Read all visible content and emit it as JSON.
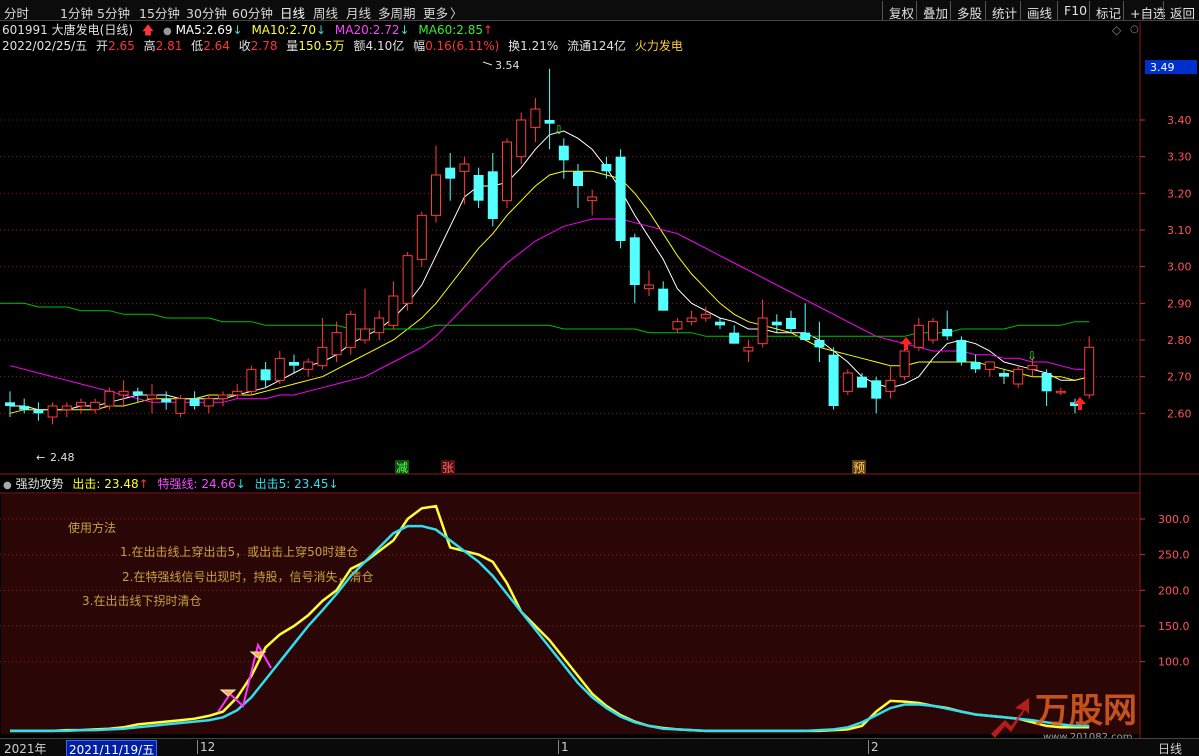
{
  "toolbar": {
    "periods": [
      "分时",
      "1分钟",
      "5分钟",
      "15分钟",
      "30分钟",
      "60分钟",
      "日线",
      "周线",
      "月线",
      "多周期",
      "更多"
    ],
    "active_period": "日线",
    "more_arrow": "〉",
    "tools": [
      "复权",
      "叠加",
      "多股",
      "统计",
      "画线",
      "F10",
      "标记",
      "+自选",
      "返回"
    ]
  },
  "stock": {
    "code": "601991",
    "name": "大唐发电(日线)",
    "ma5_label": "MA5:",
    "ma5": "2.69",
    "ma10_label": "MA10:",
    "ma10": "2.70",
    "ma20_label": "MA20:",
    "ma20": "2.72",
    "ma60_label": "MA60:",
    "ma60": "2.85",
    "date": "2022/02/25/五",
    "open_label": "开",
    "open": "2.65",
    "high_label": "高",
    "high": "2.81",
    "low_label": "低",
    "low": "2.64",
    "close_label": "收",
    "close": "2.78",
    "volume_label": "量",
    "volume": "150.5万",
    "amount_label": "额",
    "amount": "4.10亿",
    "change_label": "幅",
    "change": "0.16(6.11%)",
    "turnover_label": "换",
    "turnover": "1.21%",
    "float_label": "流通",
    "float_cap": "124亿",
    "concept": "火力发电"
  },
  "indicator": {
    "name": "强劲攻势",
    "chuji_label": "出击:",
    "chuji": "23.48",
    "teqiang_label": "特强线:",
    "teqiang": "24.66",
    "chuji5_label": "出击5:",
    "chuji5": "23.45",
    "notes": [
      "使用方法",
      "1.在出击线上穿出击5，或出击上穿50时建仓",
      "2.在特强线信号出现时，持股，信号消失，清仓",
      "3.在出击线下拐时清仓"
    ]
  },
  "markers": {
    "jian": "减",
    "zhang": "张",
    "yu": "预",
    "high_price": "3.54",
    "low_price": "2.48",
    "current_price": "3.49"
  },
  "bottom": {
    "year": "2021年",
    "cursor_date": "2021/11/19/五",
    "month12": "12",
    "month1": "1",
    "month2": "2",
    "view_mode": "日线"
  },
  "watermark": {
    "brand": "万股网",
    "site": "www.201082.com"
  },
  "colors": {
    "up": "#ff3c3c",
    "down": "#54ffff",
    "ma5": "#ffffff",
    "ma10": "#ffff00",
    "ma20": "#ff00ff",
    "ma60": "#00c000",
    "chuji": "#ffff33",
    "chuji5": "#33ddee",
    "teqiang": "#ff33ff",
    "note": "#c8a040",
    "grid": "#8a1a1a"
  },
  "chart_data": [
    {
      "type": "candlestick",
      "title": "601991 大唐发电(日线)",
      "y_ticks": [
        2.6,
        2.7,
        2.8,
        2.9,
        3.0,
        3.1,
        3.2,
        3.3,
        3.4
      ],
      "ylim": [
        2.44,
        3.58
      ],
      "candles": [
        {
          "o": 2.63,
          "h": 2.66,
          "l": 2.59,
          "c": 2.62
        },
        {
          "o": 2.62,
          "h": 2.64,
          "l": 2.6,
          "c": 2.61
        },
        {
          "o": 2.61,
          "h": 2.63,
          "l": 2.58,
          "c": 2.6
        },
        {
          "o": 2.59,
          "h": 2.63,
          "l": 2.57,
          "c": 2.62
        },
        {
          "o": 2.61,
          "h": 2.63,
          "l": 2.59,
          "c": 2.62
        },
        {
          "o": 2.62,
          "h": 2.64,
          "l": 2.6,
          "c": 2.63
        },
        {
          "o": 2.61,
          "h": 2.64,
          "l": 2.6,
          "c": 2.63
        },
        {
          "o": 2.62,
          "h": 2.67,
          "l": 2.61,
          "c": 2.66
        },
        {
          "o": 2.65,
          "h": 2.69,
          "l": 2.62,
          "c": 2.66
        },
        {
          "o": 2.66,
          "h": 2.67,
          "l": 2.63,
          "c": 2.65
        },
        {
          "o": 2.64,
          "h": 2.68,
          "l": 2.6,
          "c": 2.65
        },
        {
          "o": 2.64,
          "h": 2.66,
          "l": 2.61,
          "c": 2.63
        },
        {
          "o": 2.6,
          "h": 2.65,
          "l": 2.59,
          "c": 2.64
        },
        {
          "o": 2.64,
          "h": 2.66,
          "l": 2.61,
          "c": 2.62
        },
        {
          "o": 2.62,
          "h": 2.65,
          "l": 2.6,
          "c": 2.64
        },
        {
          "o": 2.64,
          "h": 2.66,
          "l": 2.62,
          "c": 2.65
        },
        {
          "o": 2.65,
          "h": 2.68,
          "l": 2.64,
          "c": 2.66
        },
        {
          "o": 2.66,
          "h": 2.73,
          "l": 2.65,
          "c": 2.72
        },
        {
          "o": 2.72,
          "h": 2.74,
          "l": 2.67,
          "c": 2.69
        },
        {
          "o": 2.69,
          "h": 2.77,
          "l": 2.68,
          "c": 2.75
        },
        {
          "o": 2.74,
          "h": 2.76,
          "l": 2.71,
          "c": 2.73
        },
        {
          "o": 2.72,
          "h": 2.75,
          "l": 2.7,
          "c": 2.74
        },
        {
          "o": 2.73,
          "h": 2.86,
          "l": 2.72,
          "c": 2.78
        },
        {
          "o": 2.76,
          "h": 2.85,
          "l": 2.74,
          "c": 2.82
        },
        {
          "o": 2.78,
          "h": 2.88,
          "l": 2.76,
          "c": 2.87
        },
        {
          "o": 2.8,
          "h": 2.94,
          "l": 2.79,
          "c": 2.83
        },
        {
          "o": 2.82,
          "h": 2.88,
          "l": 2.8,
          "c": 2.86
        },
        {
          "o": 2.84,
          "h": 2.96,
          "l": 2.83,
          "c": 2.92
        },
        {
          "o": 2.9,
          "h": 3.04,
          "l": 2.88,
          "c": 3.03
        },
        {
          "o": 3.02,
          "h": 3.15,
          "l": 3.0,
          "c": 3.14
        },
        {
          "o": 3.14,
          "h": 3.33,
          "l": 3.12,
          "c": 3.25
        },
        {
          "o": 3.27,
          "h": 3.31,
          "l": 3.18,
          "c": 3.24
        },
        {
          "o": 3.26,
          "h": 3.3,
          "l": 3.17,
          "c": 3.28
        },
        {
          "o": 3.25,
          "h": 3.27,
          "l": 3.16,
          "c": 3.18
        },
        {
          "o": 3.26,
          "h": 3.31,
          "l": 3.11,
          "c": 3.13
        },
        {
          "o": 3.18,
          "h": 3.35,
          "l": 3.16,
          "c": 3.34
        },
        {
          "o": 3.3,
          "h": 3.42,
          "l": 3.28,
          "c": 3.4
        },
        {
          "o": 3.38,
          "h": 3.46,
          "l": 3.34,
          "c": 3.43
        },
        {
          "o": 3.4,
          "h": 3.54,
          "l": 3.32,
          "c": 3.39
        },
        {
          "o": 3.33,
          "h": 3.35,
          "l": 3.24,
          "c": 3.29
        },
        {
          "o": 3.26,
          "h": 3.28,
          "l": 3.16,
          "c": 3.22
        },
        {
          "o": 3.18,
          "h": 3.21,
          "l": 3.14,
          "c": 3.19
        },
        {
          "o": 3.28,
          "h": 3.3,
          "l": 3.24,
          "c": 3.26
        },
        {
          "o": 3.3,
          "h": 3.32,
          "l": 3.05,
          "c": 3.07
        },
        {
          "o": 3.08,
          "h": 3.09,
          "l": 2.9,
          "c": 2.95
        },
        {
          "o": 2.94,
          "h": 2.99,
          "l": 2.92,
          "c": 2.95
        },
        {
          "o": 2.94,
          "h": 2.96,
          "l": 2.88,
          "c": 2.88
        },
        {
          "o": 2.83,
          "h": 2.86,
          "l": 2.82,
          "c": 2.85
        },
        {
          "o": 2.85,
          "h": 2.88,
          "l": 2.84,
          "c": 2.86
        },
        {
          "o": 2.86,
          "h": 2.89,
          "l": 2.85,
          "c": 2.87
        },
        {
          "o": 2.85,
          "h": 2.86,
          "l": 2.83,
          "c": 2.84
        },
        {
          "o": 2.82,
          "h": 2.84,
          "l": 2.79,
          "c": 2.79
        },
        {
          "o": 2.77,
          "h": 2.8,
          "l": 2.74,
          "c": 2.78
        },
        {
          "o": 2.79,
          "h": 2.91,
          "l": 2.78,
          "c": 2.86
        },
        {
          "o": 2.85,
          "h": 2.87,
          "l": 2.82,
          "c": 2.84
        },
        {
          "o": 2.86,
          "h": 2.88,
          "l": 2.82,
          "c": 2.83
        },
        {
          "o": 2.82,
          "h": 2.9,
          "l": 2.8,
          "c": 2.8
        },
        {
          "o": 2.8,
          "h": 2.85,
          "l": 2.74,
          "c": 2.78
        },
        {
          "o": 2.76,
          "h": 2.78,
          "l": 2.61,
          "c": 2.62
        },
        {
          "o": 2.66,
          "h": 2.72,
          "l": 2.65,
          "c": 2.71
        },
        {
          "o": 2.7,
          "h": 2.71,
          "l": 2.67,
          "c": 2.67
        },
        {
          "o": 2.69,
          "h": 2.7,
          "l": 2.6,
          "c": 2.64
        },
        {
          "o": 2.66,
          "h": 2.73,
          "l": 2.64,
          "c": 2.69
        },
        {
          "o": 2.7,
          "h": 2.78,
          "l": 2.69,
          "c": 2.77
        },
        {
          "o": 2.78,
          "h": 2.86,
          "l": 2.77,
          "c": 2.84
        },
        {
          "o": 2.8,
          "h": 2.86,
          "l": 2.79,
          "c": 2.85
        },
        {
          "o": 2.83,
          "h": 2.88,
          "l": 2.8,
          "c": 2.81
        },
        {
          "o": 2.8,
          "h": 2.81,
          "l": 2.73,
          "c": 2.74
        },
        {
          "o": 2.74,
          "h": 2.76,
          "l": 2.71,
          "c": 2.72
        },
        {
          "o": 2.72,
          "h": 2.74,
          "l": 2.7,
          "c": 2.74
        },
        {
          "o": 2.71,
          "h": 2.72,
          "l": 2.68,
          "c": 2.7
        },
        {
          "o": 2.68,
          "h": 2.73,
          "l": 2.67,
          "c": 2.72
        },
        {
          "o": 2.72,
          "h": 2.75,
          "l": 2.7,
          "c": 2.73
        },
        {
          "o": 2.71,
          "h": 2.72,
          "l": 2.62,
          "c": 2.66
        },
        {
          "o": 2.66,
          "h": 2.67,
          "l": 2.65,
          "c": 2.66
        },
        {
          "o": 2.63,
          "h": 2.64,
          "l": 2.6,
          "c": 2.62
        },
        {
          "o": 2.65,
          "h": 2.81,
          "l": 2.64,
          "c": 2.78
        }
      ],
      "series": [
        {
          "name": "MA5",
          "values": [
            2.62,
            2.62,
            2.61,
            2.61,
            2.61,
            2.62,
            2.62,
            2.63,
            2.64,
            2.65,
            2.65,
            2.65,
            2.64,
            2.64,
            2.64,
            2.64,
            2.65,
            2.66,
            2.67,
            2.69,
            2.71,
            2.73,
            2.74,
            2.76,
            2.79,
            2.81,
            2.83,
            2.86,
            2.9,
            2.95,
            3.03,
            3.11,
            3.19,
            3.22,
            3.22,
            3.23,
            3.27,
            3.32,
            3.36,
            3.37,
            3.35,
            3.32,
            3.27,
            3.21,
            3.14,
            3.08,
            3.02,
            2.94,
            2.9,
            2.88,
            2.86,
            2.85,
            2.83,
            2.83,
            2.82,
            2.82,
            2.82,
            2.8,
            2.77,
            2.74,
            2.7,
            2.68,
            2.67,
            2.68,
            2.7,
            2.75,
            2.79,
            2.8,
            2.79,
            2.77,
            2.74,
            2.73,
            2.72,
            2.71,
            2.69,
            2.69,
            2.7
          ]
        },
        {
          "name": "MA10",
          "values": [
            2.6,
            2.61,
            2.61,
            2.61,
            2.61,
            2.61,
            2.61,
            2.62,
            2.62,
            2.63,
            2.64,
            2.64,
            2.64,
            2.64,
            2.65,
            2.65,
            2.65,
            2.65,
            2.66,
            2.67,
            2.68,
            2.69,
            2.7,
            2.72,
            2.74,
            2.76,
            2.78,
            2.8,
            2.83,
            2.86,
            2.9,
            2.95,
            3.0,
            3.05,
            3.09,
            3.14,
            3.18,
            3.22,
            3.25,
            3.26,
            3.26,
            3.26,
            3.25,
            3.24,
            3.2,
            3.15,
            3.09,
            3.03,
            2.98,
            2.94,
            2.9,
            2.87,
            2.85,
            2.84,
            2.83,
            2.82,
            2.8,
            2.78,
            2.77,
            2.76,
            2.75,
            2.74,
            2.73,
            2.73,
            2.74,
            2.74,
            2.74,
            2.74,
            2.74,
            2.73,
            2.72,
            2.71,
            2.7,
            2.7,
            2.7,
            2.69,
            2.7
          ]
        },
        {
          "name": "MA20",
          "values": [
            2.73,
            2.72,
            2.71,
            2.7,
            2.69,
            2.68,
            2.67,
            2.66,
            2.65,
            2.64,
            2.63,
            2.63,
            2.63,
            2.63,
            2.63,
            2.63,
            2.64,
            2.64,
            2.64,
            2.65,
            2.65,
            2.66,
            2.67,
            2.68,
            2.69,
            2.7,
            2.72,
            2.74,
            2.76,
            2.78,
            2.81,
            2.85,
            2.89,
            2.93,
            2.97,
            3.01,
            3.04,
            3.07,
            3.09,
            3.11,
            3.12,
            3.13,
            3.13,
            3.13,
            3.12,
            3.11,
            3.1,
            3.09,
            3.07,
            3.05,
            3.03,
            3.01,
            2.99,
            2.97,
            2.95,
            2.93,
            2.91,
            2.89,
            2.87,
            2.85,
            2.83,
            2.81,
            2.8,
            2.79,
            2.78,
            2.77,
            2.77,
            2.77,
            2.76,
            2.76,
            2.75,
            2.75,
            2.74,
            2.74,
            2.73,
            2.72,
            2.72
          ]
        },
        {
          "name": "MA60",
          "values": [
            2.9,
            2.9,
            2.89,
            2.89,
            2.89,
            2.88,
            2.88,
            2.88,
            2.87,
            2.87,
            2.87,
            2.86,
            2.86,
            2.86,
            2.86,
            2.85,
            2.85,
            2.85,
            2.84,
            2.84,
            2.84,
            2.84,
            2.84,
            2.84,
            2.83,
            2.83,
            2.83,
            2.83,
            2.83,
            2.83,
            2.84,
            2.84,
            2.84,
            2.84,
            2.84,
            2.84,
            2.84,
            2.84,
            2.84,
            2.83,
            2.83,
            2.83,
            2.83,
            2.83,
            2.83,
            2.82,
            2.82,
            2.82,
            2.82,
            2.81,
            2.81,
            2.81,
            2.81,
            2.81,
            2.81,
            2.81,
            2.81,
            2.81,
            2.81,
            2.81,
            2.81,
            2.81,
            2.81,
            2.81,
            2.82,
            2.82,
            2.82,
            2.83,
            2.83,
            2.83,
            2.83,
            2.84,
            2.84,
            2.84,
            2.84,
            2.85,
            2.85
          ]
        }
      ]
    },
    {
      "type": "line",
      "title": "强劲攻势",
      "y_ticks": [
        100,
        150,
        200,
        250,
        300
      ],
      "ylim": [
        0,
        335
      ],
      "series": [
        {
          "name": "出击",
          "values": [
            3,
            3,
            3,
            3,
            4,
            4,
            5,
            6,
            8,
            12,
            14,
            16,
            18,
            20,
            24,
            30,
            50,
            80,
            120,
            138,
            150,
            165,
            185,
            200,
            230,
            240,
            255,
            270,
            300,
            315,
            318,
            260,
            255,
            250,
            240,
            210,
            170,
            150,
            130,
            105,
            80,
            55,
            38,
            25,
            16,
            10,
            7,
            5,
            4,
            3,
            3,
            3,
            3,
            3,
            3,
            3,
            3,
            3,
            4,
            5,
            10,
            30,
            45,
            44,
            42,
            38,
            35,
            30,
            26,
            24,
            22,
            20,
            15,
            10,
            8,
            8,
            8
          ]
        },
        {
          "name": "出击5",
          "values": [
            3,
            3,
            3,
            3,
            3,
            4,
            4,
            5,
            6,
            8,
            10,
            12,
            14,
            16,
            18,
            22,
            32,
            50,
            75,
            100,
            125,
            150,
            172,
            195,
            220,
            240,
            260,
            280,
            290,
            290,
            285,
            270,
            255,
            240,
            220,
            195,
            170,
            145,
            120,
            95,
            70,
            50,
            35,
            23,
            15,
            10,
            6,
            5,
            4,
            3,
            3,
            3,
            3,
            3,
            3,
            3,
            3,
            4,
            5,
            8,
            15,
            25,
            35,
            40,
            40,
            38,
            34,
            30,
            26,
            24,
            22,
            20,
            18,
            15,
            12,
            10,
            10
          ]
        }
      ]
    }
  ]
}
